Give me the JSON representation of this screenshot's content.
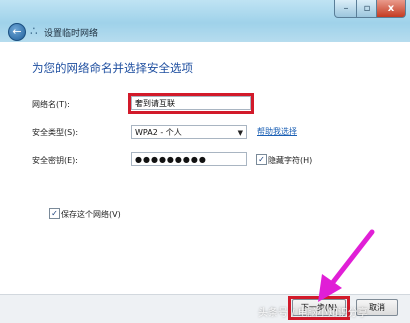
{
  "window": {
    "title": "设置临时网络",
    "controls": {
      "minimize": "–",
      "maximize": "▫",
      "close": "x"
    }
  },
  "main": {
    "heading": "为您的网络命名并选择安全选项",
    "network_name": {
      "label": "网络名(T):",
      "value": "奢到请互联"
    },
    "security_type": {
      "label": "安全类型(S):",
      "value": "WPA2 - 个人",
      "help_link": "帮助我选择"
    },
    "security_key": {
      "label": "安全密钥(E):",
      "value": "●●●●●●●●●",
      "hide_chars_label": "隐藏字符(H)",
      "hide_chars_checked": true
    },
    "save_network": {
      "label": "保存这个网络(V)",
      "checked": true
    }
  },
  "footer": {
    "next_label": "下一步(N)",
    "cancel_label": "取消"
  },
  "watermark": "头条号 / 电脑小知识分享",
  "colors": {
    "highlight": "#d21a2a",
    "arrow": "#e01fd6",
    "heading": "#1f4fa0",
    "link": "#1a5fb4"
  }
}
